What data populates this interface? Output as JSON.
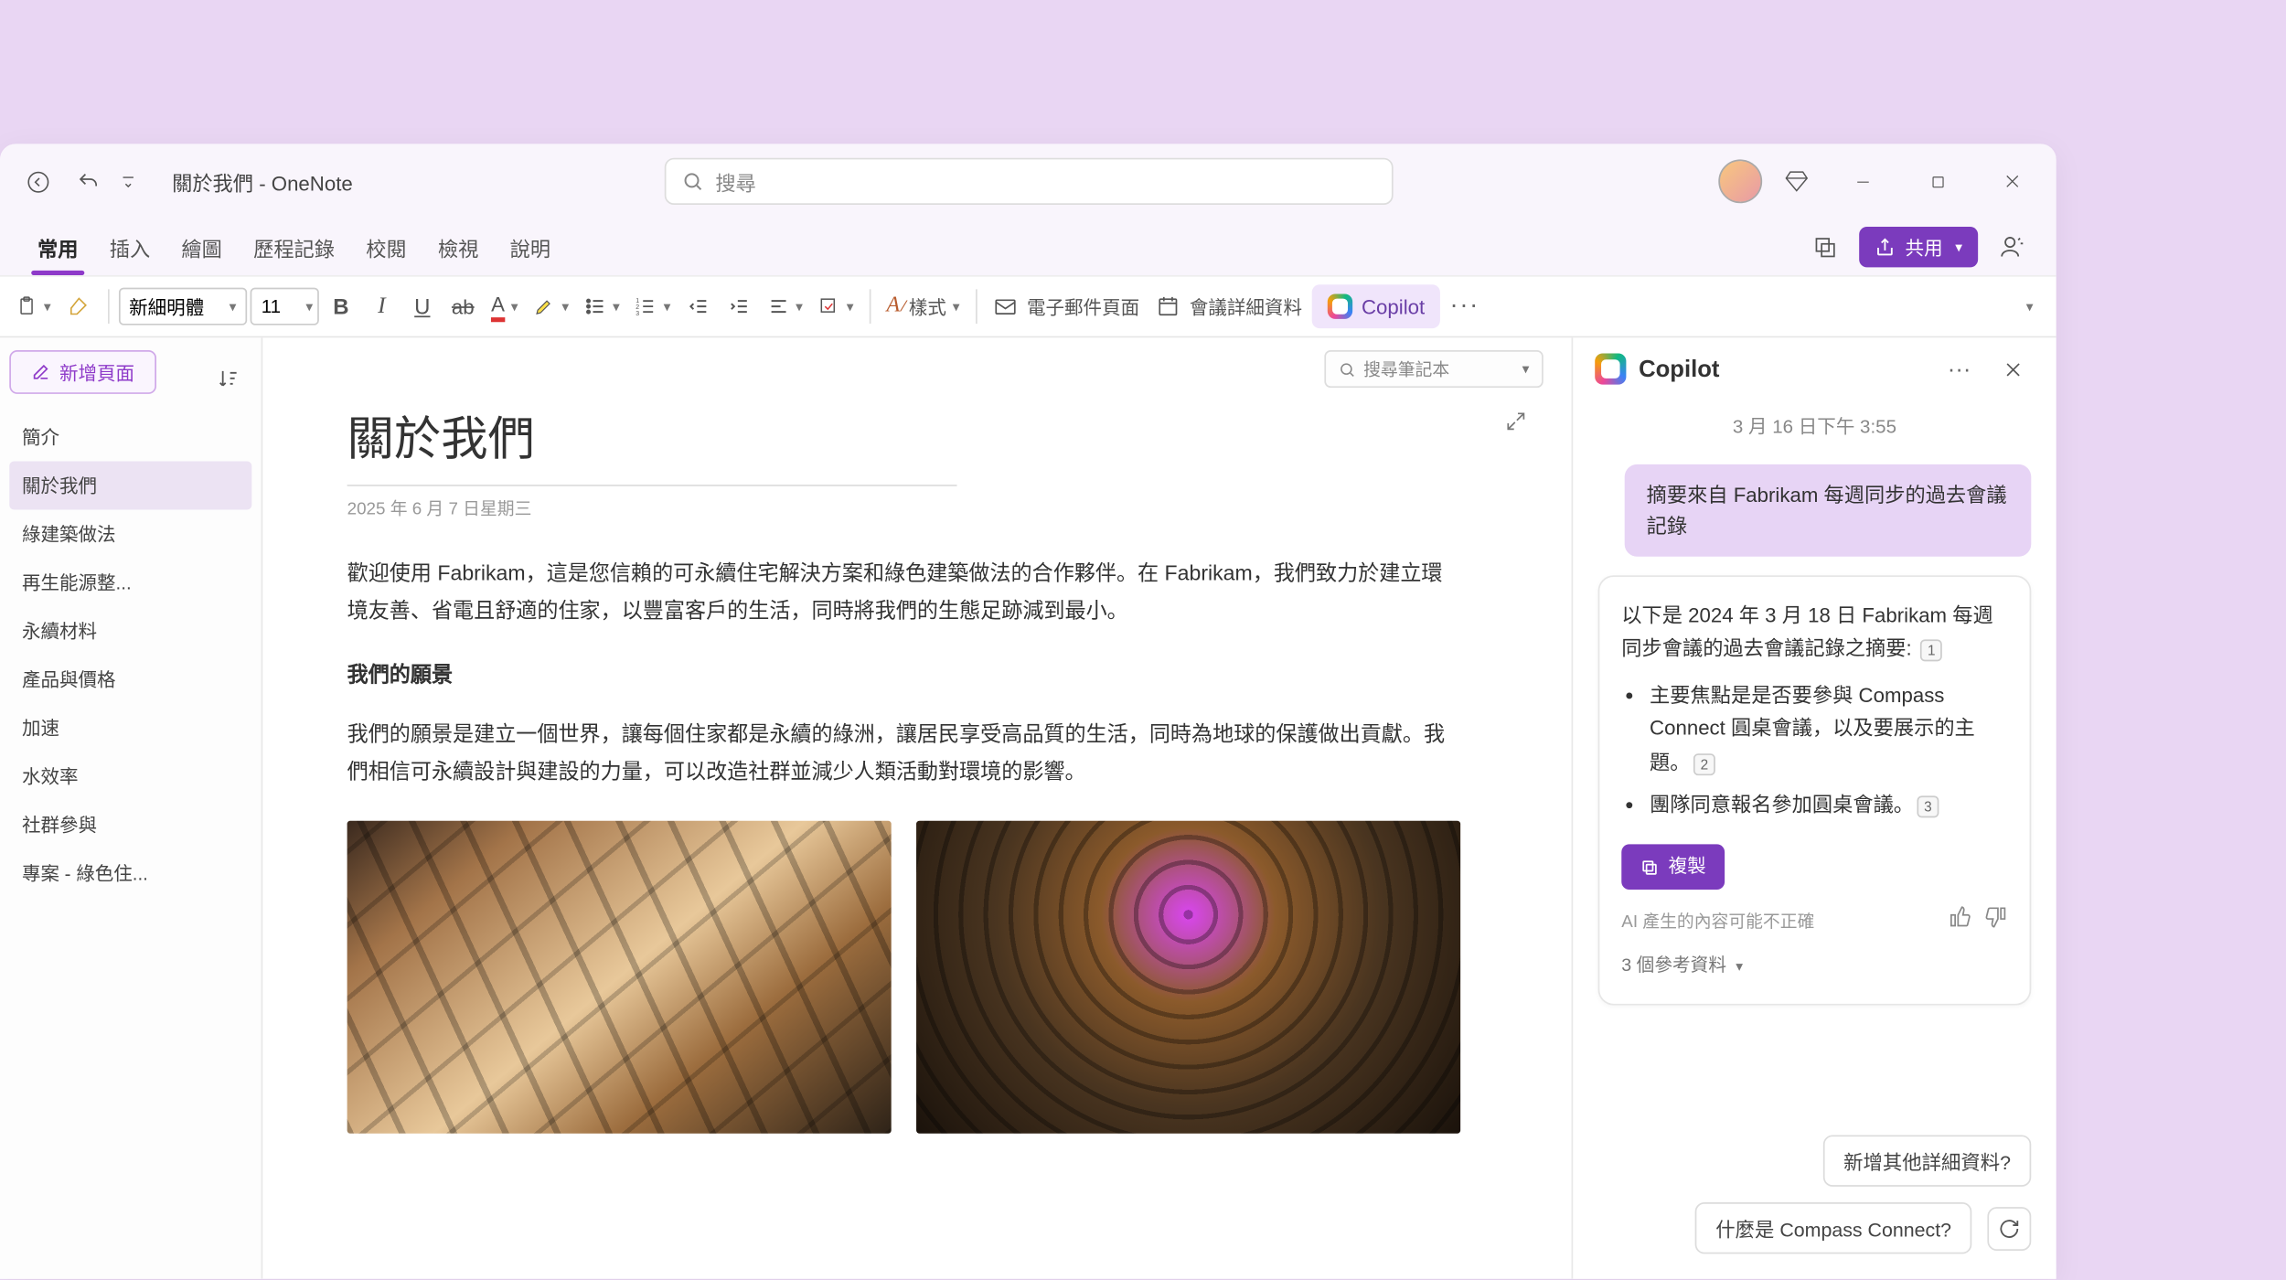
{
  "window": {
    "title": "關於我們 - OneNote",
    "search_placeholder": "搜尋"
  },
  "ribbon": {
    "tabs": [
      "常用",
      "插入",
      "繪圖",
      "歷程記錄",
      "校閱",
      "檢視",
      "說明"
    ],
    "share_label": "共用"
  },
  "toolbar": {
    "font": "新細明體",
    "font_size": "11",
    "styles_label": "樣式",
    "email_label": "電子郵件頁面",
    "meeting_label": "會議詳細資料",
    "copilot_label": "Copilot"
  },
  "sidebar": {
    "new_page": "新增頁面",
    "items": [
      "簡介",
      "關於我們",
      "綠建築做法",
      "再生能源整...",
      "永續材料",
      "產品與價格",
      "加速",
      "水效率",
      "社群參與",
      "專案 - 綠色住..."
    ]
  },
  "notebook_search": "搜尋筆記本",
  "note": {
    "title": "關於我們",
    "date": "2025 年 6 月 7 日星期三",
    "paragraph1": "歡迎使用 Fabrikam，這是您信賴的可永續住宅解決方案和綠色建築做法的合作夥伴。在 Fabrikam，我們致力於建立環境友善、省電且舒適的住家，以豐富客戶的生活，同時將我們的生態足跡減到最小。",
    "heading1": "我們的願景",
    "paragraph2": "我們的願景是建立一個世界，讓每個住家都是永續的綠洲，讓居民享受高品質的生活，同時為地球的保護做出貢獻。我們相信可永續設計與建設的力量，可以改造社群並減少人類活動對環境的影響。"
  },
  "copilot": {
    "panel_title": "Copilot",
    "timestamp": "3 月 16 日下午 3:55",
    "user_message": "摘要來自 Fabrikam 每週同步的過去會議記錄",
    "ai_intro": "以下是 2024 年 3 月 18 日 Fabrikam 每週同步會議的過去會議記錄之摘要:",
    "ai_ref_intro": "1",
    "bullets": [
      {
        "text": "主要焦點是是否要參與 Compass Connect 圓桌會議，以及要展示的主題。",
        "ref": "2"
      },
      {
        "text": "團隊同意報名參加圓桌會議。",
        "ref": "3"
      }
    ],
    "copy_label": "複製",
    "disclaimer": "AI 產生的內容可能不正確",
    "references_label": "3 個參考資料",
    "suggestions": [
      "新增其他詳細資料?",
      "什麼是 Compass Connect?"
    ]
  }
}
